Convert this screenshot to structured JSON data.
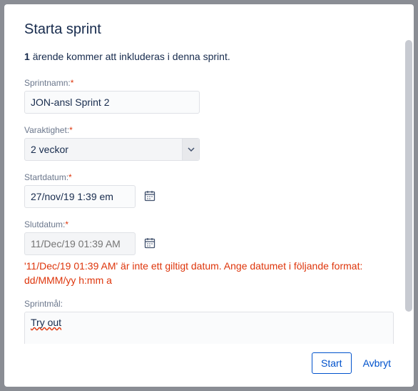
{
  "title": "Starta sprint",
  "info": {
    "count": "1",
    "text": "ärende kommer att inkluderas i denna sprint."
  },
  "fields": {
    "name": {
      "label": "Sprintnamn:",
      "value": "JON-ansl Sprint 2"
    },
    "duration": {
      "label": "Varaktighet:",
      "value": "2 veckor"
    },
    "start": {
      "label": "Startdatum:",
      "value": "27/nov/19 1:39 em"
    },
    "end": {
      "label": "Slutdatum:",
      "placeholder": "11/Dec/19 01:39 AM",
      "error": "'11/Dec/19 01:39 AM' är inte ett giltigt datum. Ange datumet i följande format: dd/MMM/yy h:mm a"
    },
    "goal": {
      "label": "Sprintmål:",
      "value": "Try out"
    }
  },
  "buttons": {
    "start": "Start",
    "cancel": "Avbryt"
  }
}
